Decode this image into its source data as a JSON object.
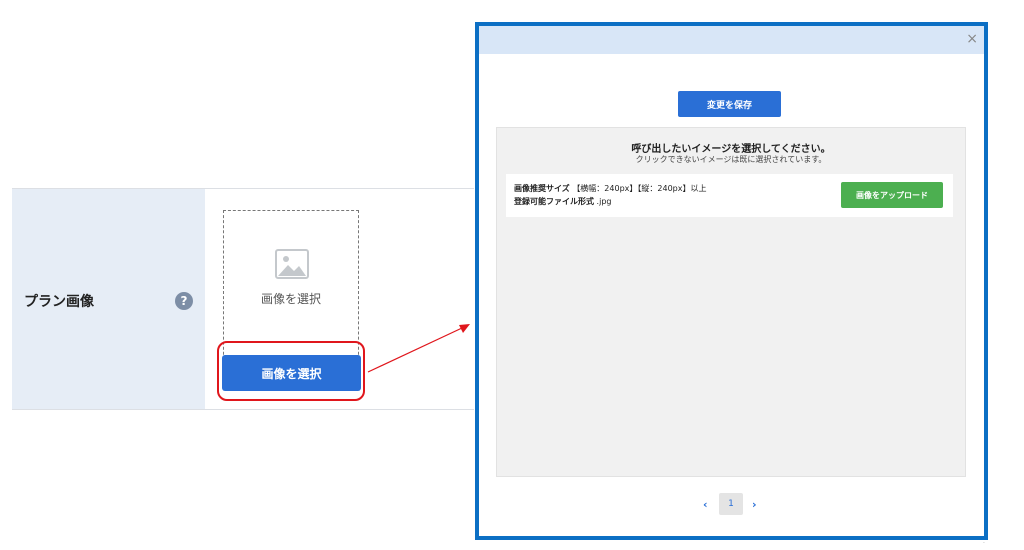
{
  "form": {
    "label": "プラン画像",
    "help_icon": "?",
    "image_box_label": "画像を選択",
    "select_button": "画像を選択"
  },
  "modal": {
    "close_icon": "×",
    "save_button": "変更を保存",
    "gallery": {
      "title": "呼び出したいイメージを選択してください。",
      "subtitle": "クリックできないイメージは既に選択されています。",
      "recommended_size_label": "画像推奨サイズ",
      "recommended_size_value": "【横幅：240px】【縦：240px】以上",
      "allowed_format_label": "登録可能ファイル形式",
      "allowed_format_value": ".jpg",
      "upload_button": "画像をアップロード"
    },
    "pagination": {
      "prev": "‹",
      "page": "1",
      "next": "›"
    }
  },
  "colors": {
    "primary_button": "#2a6fd6",
    "upload_button": "#4caf50",
    "modal_border": "#0c6fc4",
    "highlight": "#e0161c",
    "label_cell": "#e6edf6"
  },
  "icons": {
    "help": "question-circle-icon",
    "image_placeholder": "image-icon",
    "close": "close-icon",
    "prev": "chevron-left-icon",
    "next": "chevron-right-icon"
  }
}
